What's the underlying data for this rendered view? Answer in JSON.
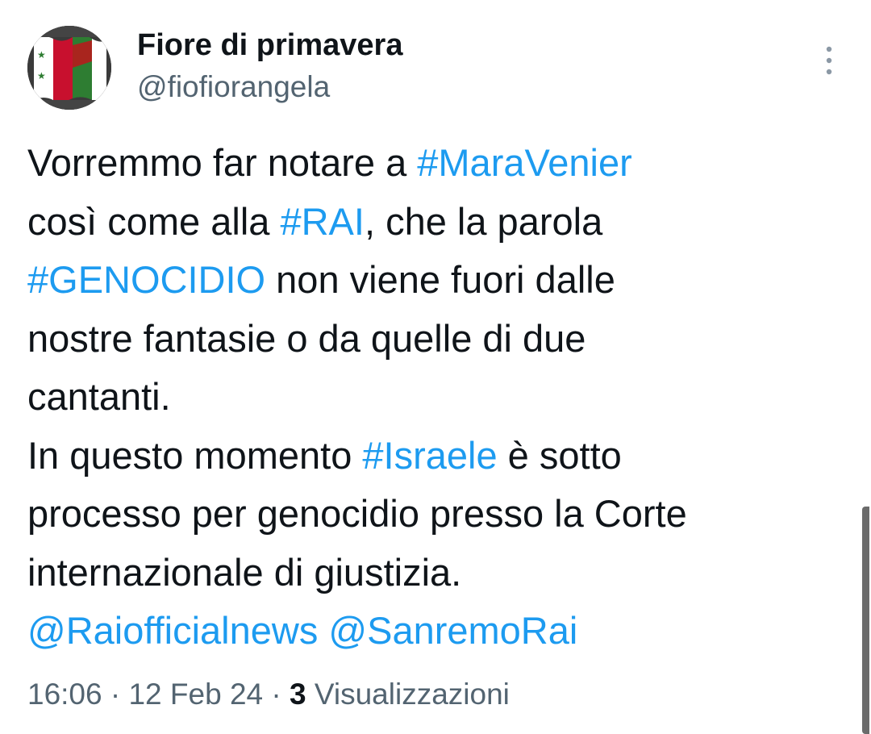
{
  "author": {
    "display_name": "Fiore di primavera",
    "handle": "@fiofiorangela"
  },
  "icons": {
    "more": "more-vertical-icon",
    "avatar": "flag-avatar-icon"
  },
  "tweet": {
    "lines": [
      [
        {
          "t": "Vorremmo far notare a "
        },
        {
          "t": "#MaraVenier",
          "kind": "tag"
        }
      ],
      [
        {
          "t": "così come alla "
        },
        {
          "t": "#RAI",
          "kind": "tag"
        },
        {
          "t": ", che la parola"
        }
      ],
      [
        {
          "t": "#GENOCIDIO",
          "kind": "tag"
        },
        {
          "t": " non viene fuori dalle"
        }
      ],
      [
        {
          "t": "nostre fantasie o da quelle di due"
        }
      ],
      [
        {
          "t": "cantanti."
        }
      ],
      [
        {
          "t": "In questo momento "
        },
        {
          "t": "#Israele",
          "kind": "tag"
        },
        {
          "t": " è sotto"
        }
      ],
      [
        {
          "t": "processo per genocidio presso la Corte"
        }
      ],
      [
        {
          "t": "internazionale di giustizia."
        }
      ],
      [
        {
          "t": "@Raiofficialnews",
          "kind": "mention"
        },
        {
          "t": " "
        },
        {
          "t": "@SanremoRai",
          "kind": "mention"
        }
      ]
    ]
  },
  "meta": {
    "time": "16:06",
    "sep1": " · ",
    "date": "12 Feb 24",
    "sep2": " · ",
    "views_count": "3",
    "views_label": " Visualizzazioni"
  },
  "colors": {
    "link": "#1d9bf0",
    "secondary_text": "#536471",
    "primary_text": "#0f1419"
  }
}
